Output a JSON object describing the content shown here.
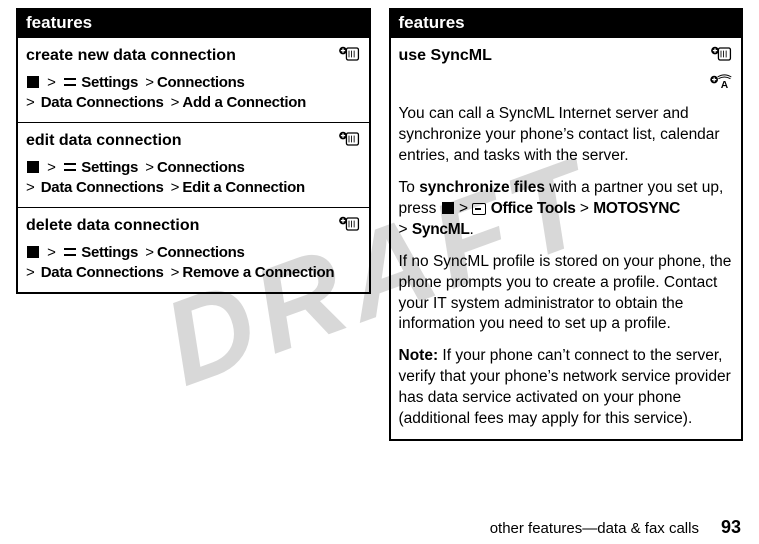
{
  "watermark": "DRAFT",
  "left": {
    "header": "features",
    "rows": [
      {
        "title": "create new data connection",
        "steps": [
          "Settings",
          "Connections",
          "Data Connections",
          "Add a Connection"
        ]
      },
      {
        "title": "edit data connection",
        "steps": [
          "Settings",
          "Connections",
          "Data Connections",
          "Edit a Connection"
        ]
      },
      {
        "title": "delete data connection",
        "steps": [
          "Settings",
          "Connections",
          "Data Connections",
          "Remove a Connection"
        ]
      }
    ]
  },
  "right": {
    "header": "features",
    "syncml": {
      "title": "use SyncML",
      "p1": "You can call a SyncML Internet server and synchronize your phone’s contact list, calendar entries, and tasks with the server.",
      "p2_prefix": "To ",
      "p2_bold": "synchronize files",
      "p2_mid": " with a partner you set up, press ",
      "p2_path": [
        "Office Tools",
        "MOTOSYNC",
        "SyncML"
      ],
      "p3": "If no SyncML profile is stored on your phone, the phone prompts you to create a profile. Contact your IT system administrator to obtain the information you need to set up a profile.",
      "note_label": "Note:",
      "note_text": " If your phone can’t connect to the server, verify that your phone’s network service provider has data service activated on your phone (additional fees may apply for this service)."
    }
  },
  "footer": {
    "section": "other features—data & fax calls",
    "page": "93"
  }
}
